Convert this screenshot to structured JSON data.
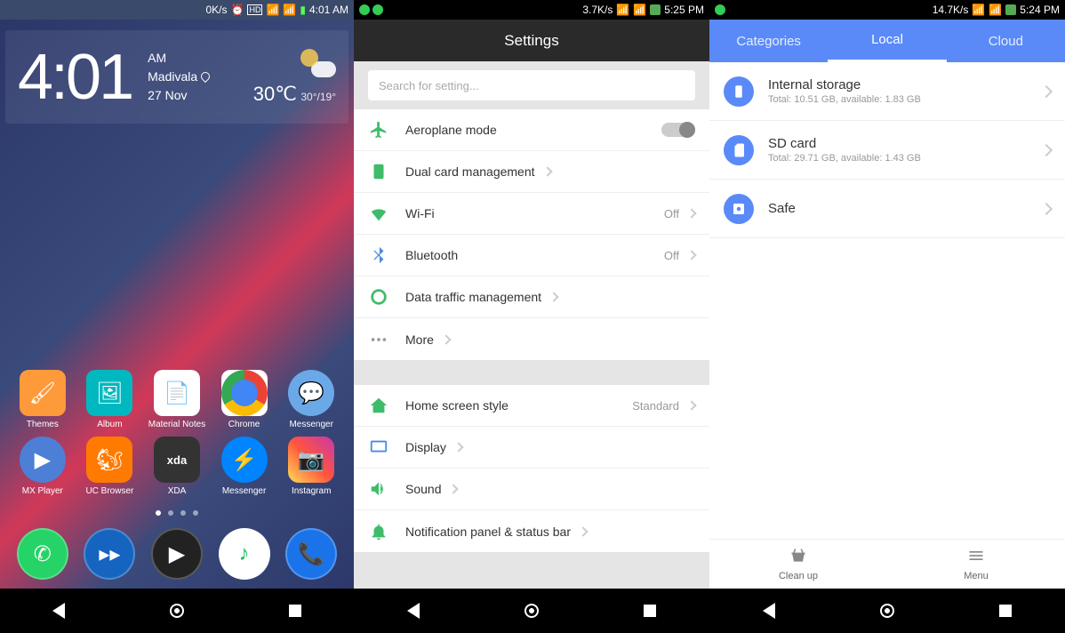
{
  "screen1": {
    "statusbar": {
      "speed": "0K/s",
      "time": "4:01 AM"
    },
    "weather": {
      "bigTime": "4:01",
      "ampm": "AM",
      "location": "Madivala",
      "date": "27 Nov",
      "temp": "30℃",
      "range": "30°/19°"
    },
    "apps_row1": [
      {
        "label": "Themes",
        "ic": "ic-themes",
        "glyph": "🖌"
      },
      {
        "label": "Album",
        "ic": "ic-album",
        "glyph": "🖼"
      },
      {
        "label": "Material Notes",
        "ic": "ic-notes",
        "glyph": "📄"
      },
      {
        "label": "Chrome",
        "ic": "ic-chrome",
        "glyph": ""
      },
      {
        "label": "Messenger",
        "ic": "ic-msgr",
        "glyph": "💬"
      }
    ],
    "apps_row2": [
      {
        "label": "MX Player",
        "ic": "ic-mx",
        "glyph": "▶"
      },
      {
        "label": "UC Browser",
        "ic": "ic-uc",
        "glyph": "🐿"
      },
      {
        "label": "XDA",
        "ic": "ic-xda",
        "glyph": "xda"
      },
      {
        "label": "Messenger",
        "ic": "ic-fbm",
        "glyph": "⚡"
      },
      {
        "label": "Instagram",
        "ic": "ic-ig",
        "glyph": "📷"
      }
    ],
    "dock": [
      {
        "ic": "ic-wa",
        "glyph": "✆",
        "name": "whatsapp"
      },
      {
        "ic": "ic-mix",
        "glyph": "▸▸",
        "name": "mixplorer"
      },
      {
        "ic": "ic-play",
        "glyph": "▶",
        "name": "play"
      },
      {
        "ic": "ic-music",
        "glyph": "♪",
        "name": "music"
      },
      {
        "ic": "ic-phone",
        "glyph": "📞",
        "name": "phone"
      }
    ]
  },
  "screen2": {
    "statusbar": {
      "speed": "3.7K/s",
      "time": "5:25 PM"
    },
    "title": "Settings",
    "searchPlaceholder": "Search for setting...",
    "group1": [
      {
        "icon": "plane",
        "color": "#3fbc6a",
        "label": "Aeroplane mode",
        "type": "toggle"
      },
      {
        "icon": "sim",
        "color": "#3fbc6a",
        "label": "Dual card management",
        "type": "nav"
      },
      {
        "icon": "wifi",
        "color": "#3fbc6a",
        "label": "Wi-Fi",
        "type": "nav",
        "value": "Off"
      },
      {
        "icon": "bt",
        "color": "#4a8ae8",
        "label": "Bluetooth",
        "type": "nav",
        "value": "Off"
      },
      {
        "icon": "data",
        "color": "#3fbc6a",
        "label": "Data traffic management",
        "type": "nav"
      },
      {
        "icon": "more",
        "color": "#999",
        "label": "More",
        "type": "nav"
      }
    ],
    "group2": [
      {
        "icon": "home",
        "color": "#3fbc6a",
        "label": "Home screen style",
        "type": "nav",
        "value": "Standard"
      },
      {
        "icon": "display",
        "color": "#4a8ae8",
        "label": "Display",
        "type": "nav"
      },
      {
        "icon": "sound",
        "color": "#3fbc6a",
        "label": "Sound",
        "type": "nav"
      },
      {
        "icon": "notif",
        "color": "#3fbc6a",
        "label": "Notification panel & status bar",
        "type": "nav"
      }
    ]
  },
  "screen3": {
    "statusbar": {
      "speed": "14.7K/s",
      "time": "5:24 PM"
    },
    "tabs": [
      "Categories",
      "Local",
      "Cloud"
    ],
    "activeTab": 1,
    "items": [
      {
        "title": "Internal storage",
        "sub": "Total: 10.51 GB, available: 1.83 GB",
        "icon": "phone"
      },
      {
        "title": "SD card",
        "sub": "Total: 29.71 GB, available: 1.43 GB",
        "icon": "sd"
      },
      {
        "title": "Safe",
        "sub": "",
        "icon": "safe"
      }
    ],
    "bottom": [
      {
        "label": "Clean up",
        "icon": "clean"
      },
      {
        "label": "Menu",
        "icon": "menu"
      }
    ]
  }
}
